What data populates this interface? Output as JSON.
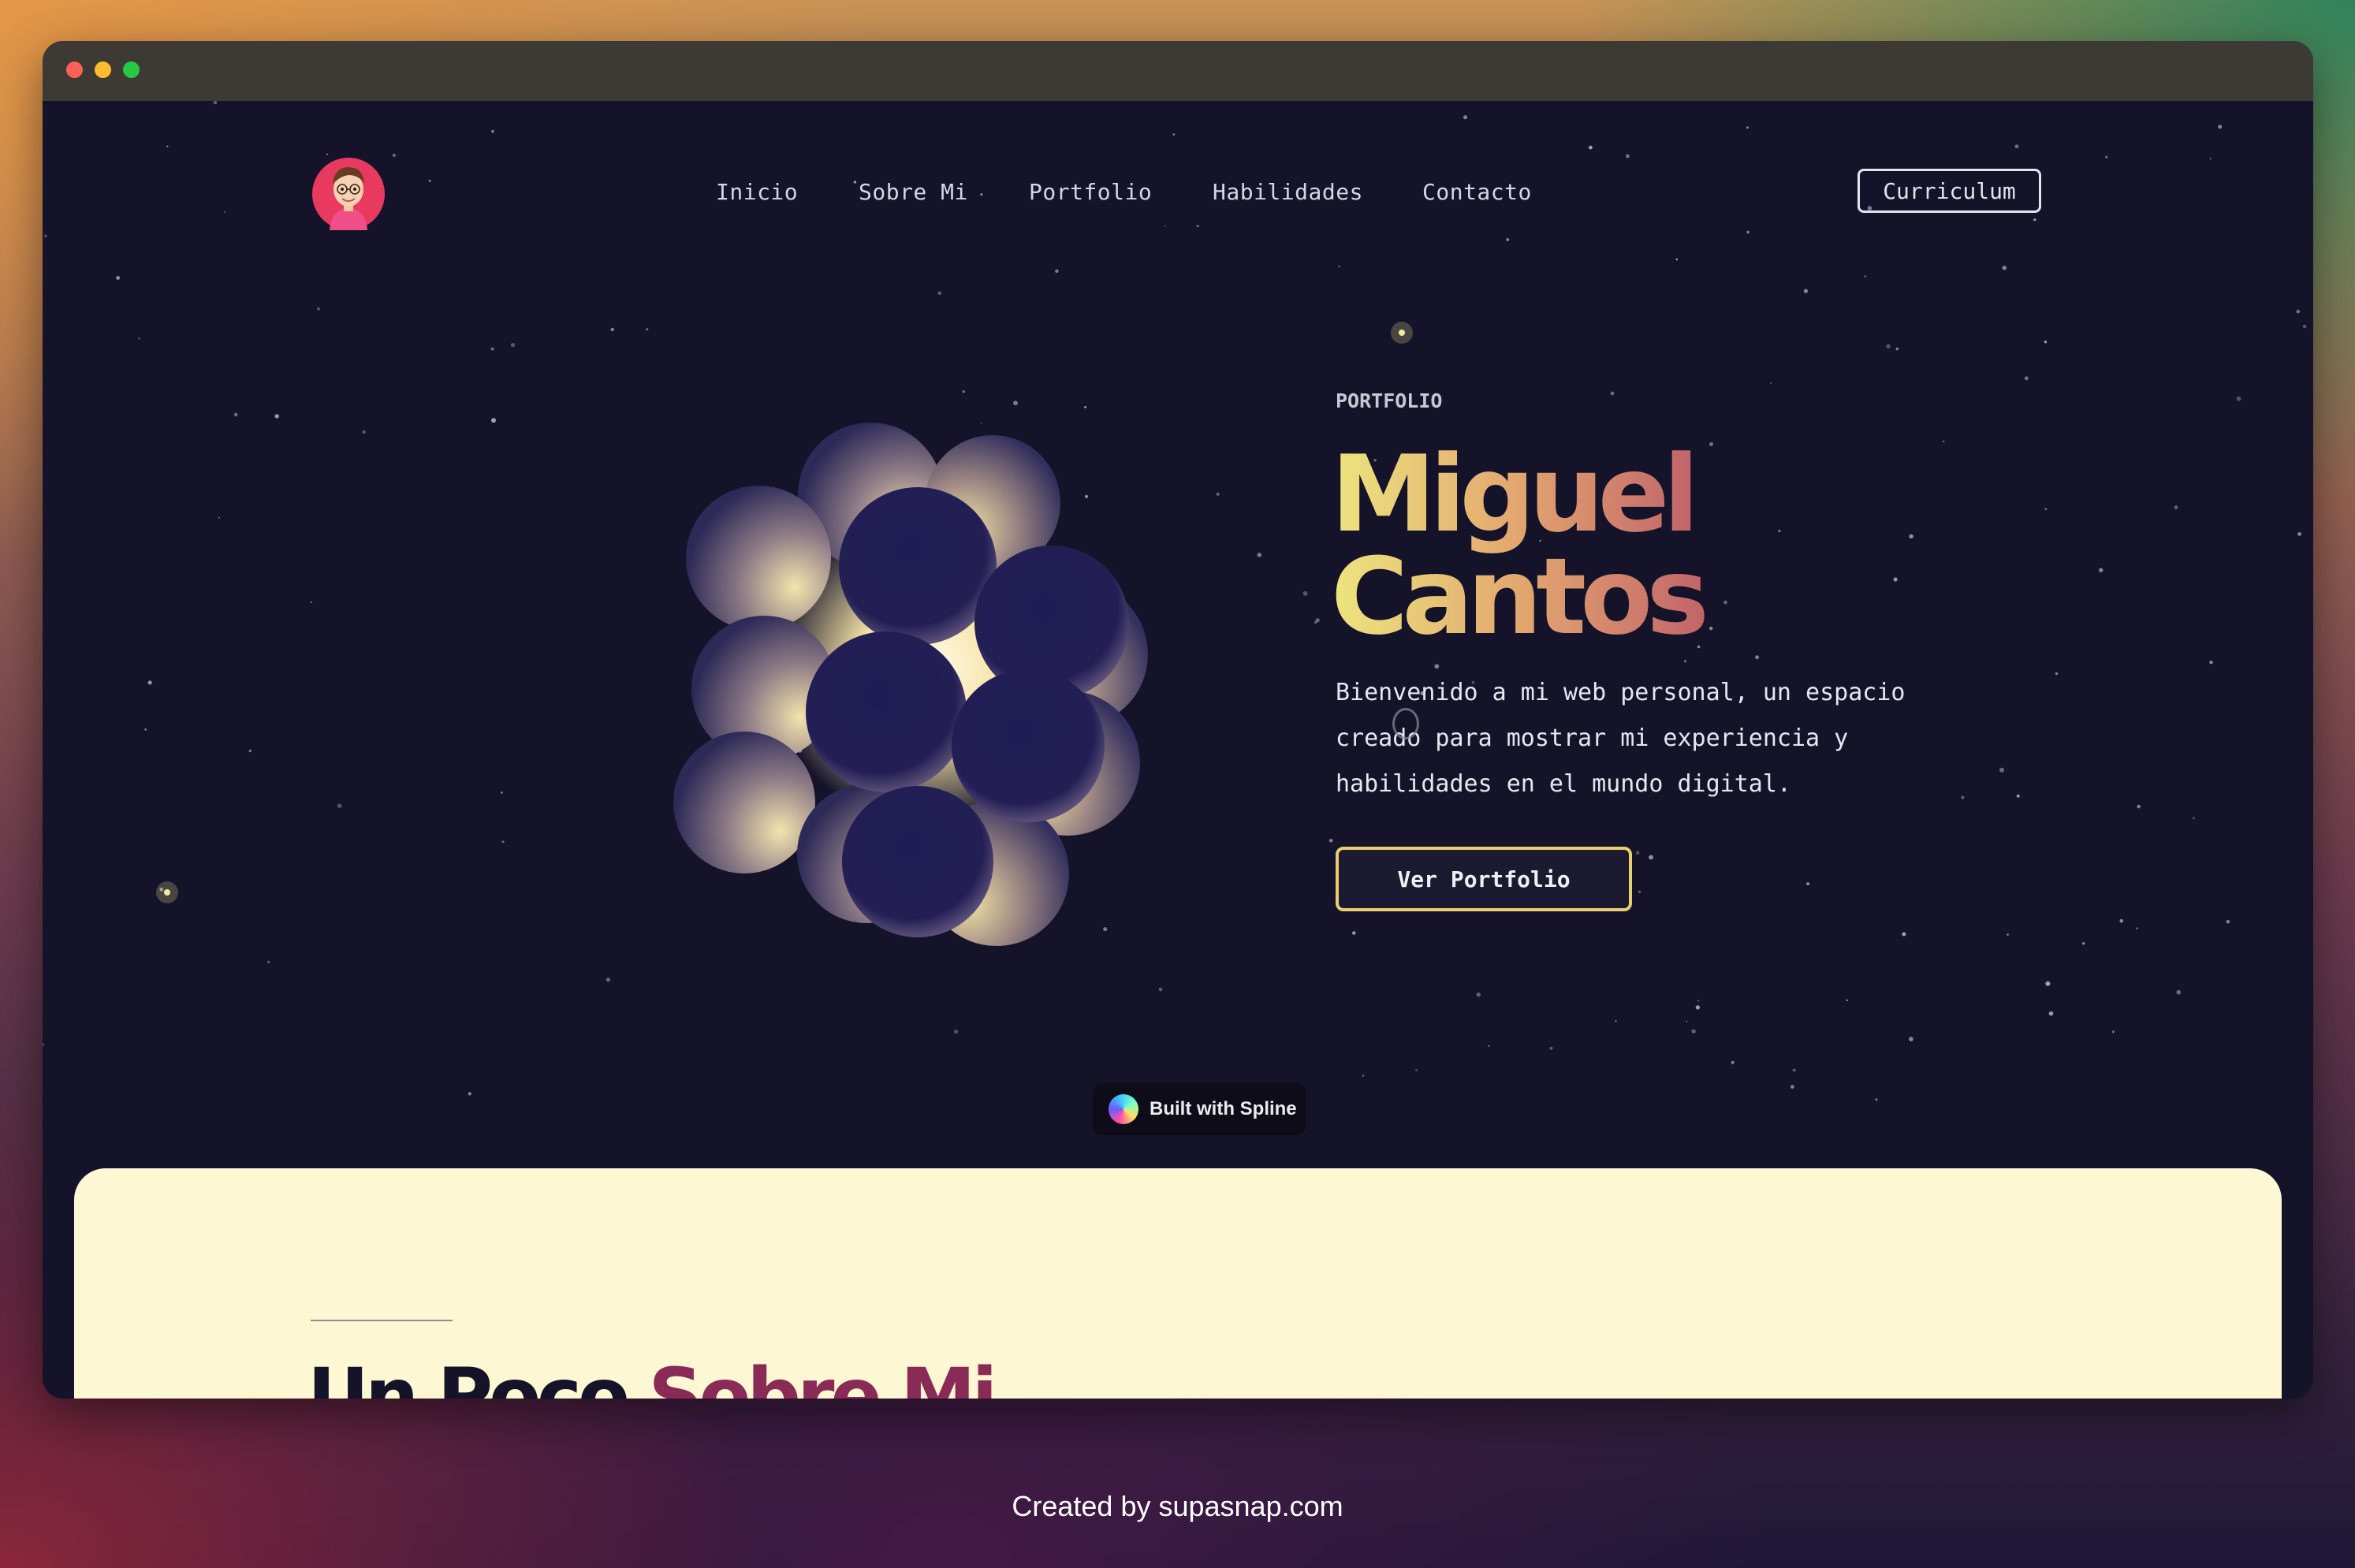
{
  "window": {
    "traffic_lights": [
      "close",
      "minimize",
      "maximize"
    ]
  },
  "header": {
    "avatar_icon": "memoji-avatar-icon",
    "nav": [
      {
        "label": "Inicio"
      },
      {
        "label": "Sobre Mi"
      },
      {
        "label": "Portfolio"
      },
      {
        "label": "Habilidades"
      },
      {
        "label": "Contacto"
      }
    ],
    "cv_button": "Curriculum"
  },
  "hero": {
    "eyebrow": "PORTFOLIO",
    "name_line1": "Miguel",
    "name_line2": "Cantos",
    "intro": "Bienvenido a mi web personal, un espacio creado para mostrar mi experiencia y habilidades en el mundo digital.",
    "cta": "Ver Portfolio",
    "orb_graphic": "glowing-sphere-cluster"
  },
  "badge": {
    "label": "Built with Spline",
    "icon": "spline-logo-icon"
  },
  "about": {
    "title_part1": "Un Poco ",
    "title_part2": "Sobre Mi."
  },
  "footer_credit": "Created by supasnap.com",
  "colors": {
    "page_bg": "#15132a",
    "name_gradient_start": "#ede57f",
    "name_gradient_mid": "#e3a86f",
    "name_gradient_end": "#c2646a",
    "cta_border": "#e9cf73",
    "about_bg": "#fdf8d3",
    "about_title_dark": "#15132a",
    "about_title_accent": "#8a2a57"
  }
}
